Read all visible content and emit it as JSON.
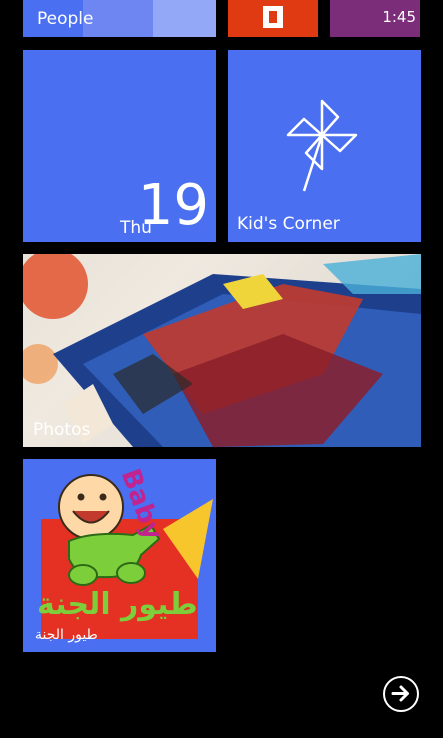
{
  "status": {
    "time": "1:45"
  },
  "tiles": {
    "people": {
      "label": "People"
    },
    "calendar": {
      "day": "Thu",
      "date": "19"
    },
    "kids_corner": {
      "label": "Kid's Corner"
    },
    "photos": {
      "label": "Photos"
    },
    "baby_app": {
      "logo_text": "Baby",
      "arabic_title": "طيور الجنة",
      "arabic_caption": "طيور الجنة"
    }
  },
  "colors": {
    "accent": "#4a6ff0",
    "office": "#e03a12",
    "clock_tile": "#7b2d7a"
  },
  "icons": {
    "nav": "arrow-right-circle-icon",
    "kids": "pinwheel-icon"
  }
}
